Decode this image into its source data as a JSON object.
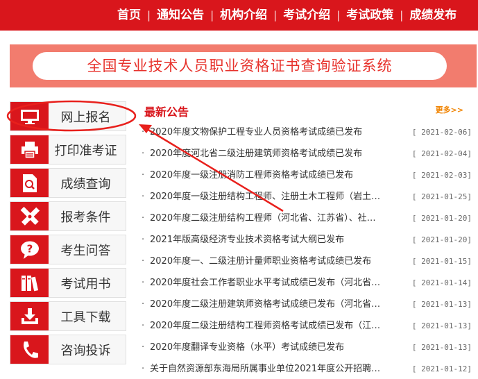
{
  "nav": {
    "items": [
      "首页",
      "通知公告",
      "机构介绍",
      "考试介绍",
      "考试政策",
      "成绩发布"
    ],
    "separator": "|"
  },
  "banner": {
    "title": "全国专业技术人员职业资格证书查询验证系统"
  },
  "sidebar": {
    "items": [
      {
        "label": "网上报名",
        "icon": "monitor-icon"
      },
      {
        "label": "打印准考证",
        "icon": "printer-icon"
      },
      {
        "label": "成绩查询",
        "icon": "document-search-icon"
      },
      {
        "label": "报考条件",
        "icon": "pencil-ruler-icon"
      },
      {
        "label": "考生问答",
        "icon": "question-bubble-icon"
      },
      {
        "label": "考试用书",
        "icon": "books-icon"
      },
      {
        "label": "工具下载",
        "icon": "download-icon"
      },
      {
        "label": "咨询投诉",
        "icon": "phone-icon"
      }
    ]
  },
  "notices": {
    "title": "最新公告",
    "more": "更多>>",
    "items": [
      {
        "title": "2020年度文物保护工程专业人员资格考试成绩已发布",
        "date": "[ 2021-02-06]"
      },
      {
        "title": "2020年度河北省二级注册建筑师资格考试成绩已发布",
        "date": "[ 2021-02-04]"
      },
      {
        "title": "2020年度一级注册消防工程师资格考试成绩已发布",
        "date": "[ 2021-02-03]"
      },
      {
        "title": "2020年度一级注册结构工程师、注册土木工程师（岩土…",
        "date": "[ 2021-01-25]"
      },
      {
        "title": "2020年度二级注册结构工程师（河北省、江苏省）、社…",
        "date": "[ 2021-01-20]"
      },
      {
        "title": "2021年版高级经济专业技术资格考试大纲已发布",
        "date": "[ 2021-01-20]"
      },
      {
        "title": "2020年度一、二级注册计量师职业资格考试成绩已发布",
        "date": "[ 2021-01-15]"
      },
      {
        "title": "2020年度社会工作者职业水平考试成绩已发布（河北省…",
        "date": "[ 2021-01-14]"
      },
      {
        "title": "2020年度二级注册建筑师资格考试成绩已发布（河北省…",
        "date": "[ 2021-01-13]"
      },
      {
        "title": "2020年度二级注册结构工程师资格考试成绩已发布（江…",
        "date": "[ 2021-01-13]"
      },
      {
        "title": "2020年度翻译专业资格（水平）考试成绩已发布",
        "date": "[ 2021-01-13]"
      },
      {
        "title": "关于自然资源部东海局所属事业单位2021年度公开招聘…",
        "date": "[ 2021-01-12]"
      }
    ]
  },
  "colors": {
    "brand_red": "#d9161c",
    "banner_bg": "#f27c6e",
    "more_orange": "#f08300",
    "annotation_red": "#e8201c"
  }
}
